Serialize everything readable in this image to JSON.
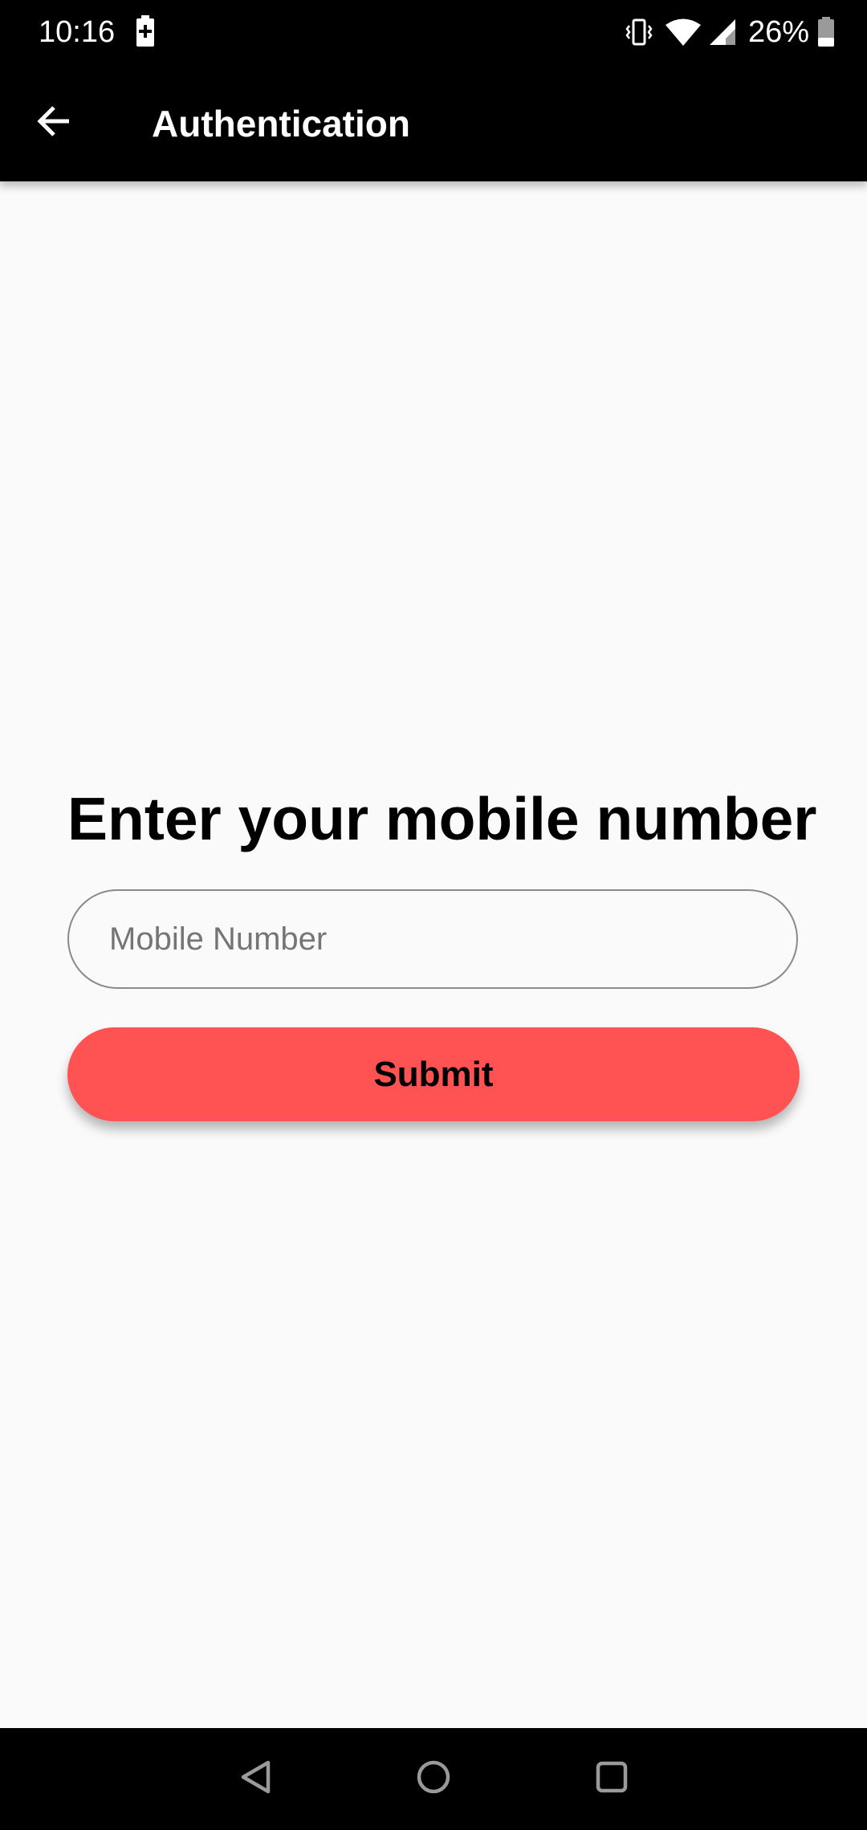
{
  "status_bar": {
    "time": "10:16",
    "battery_percent": "26%",
    "icons": [
      "battery-charging-icon",
      "vibrate-icon",
      "wifi-icon",
      "cell-signal-icon",
      "battery-icon"
    ]
  },
  "app_bar": {
    "title": "Authentication",
    "back_icon": "arrow-back-icon"
  },
  "main": {
    "heading": "Enter your mobile number",
    "mobile_input": {
      "placeholder": "Mobile Number",
      "value": ""
    },
    "submit_label": "Submit"
  },
  "nav_bar": {
    "icons": [
      "back-triangle-icon",
      "home-circle-icon",
      "recents-square-icon"
    ]
  },
  "colors": {
    "app_bar": "#000000",
    "background": "#fafafa",
    "accent": "#ff5252"
  }
}
